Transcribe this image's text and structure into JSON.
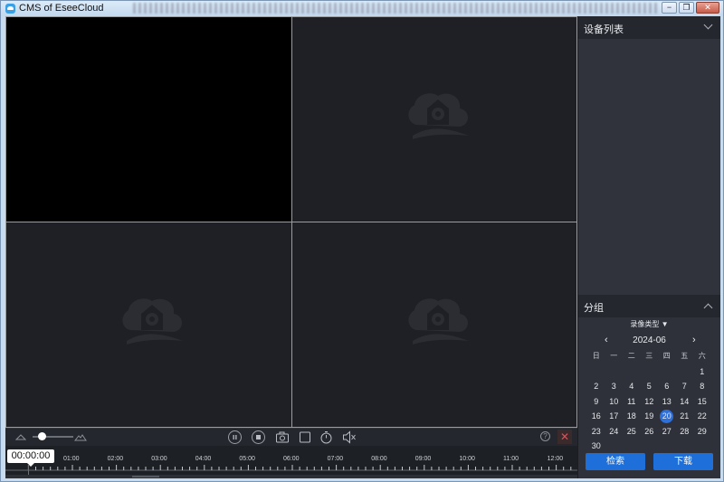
{
  "window": {
    "title": "CMS of EseeCloud",
    "minimize_label": "−",
    "restore_label": "❐",
    "close_label": "✕"
  },
  "panes": [
    {
      "name": "channel-1",
      "state": "black"
    },
    {
      "name": "channel-2",
      "state": "logo"
    },
    {
      "name": "channel-3",
      "state": "logo"
    },
    {
      "name": "channel-4",
      "state": "logo"
    }
  ],
  "controls": {
    "close_icon": "✕",
    "help_icon": "?"
  },
  "timeline": {
    "current_time": "00:00:00",
    "labels": [
      "01:00",
      "02:00",
      "03:00",
      "04:00",
      "05:00",
      "06:00",
      "07:00",
      "08:00",
      "09:00",
      "10:00",
      "11:00",
      "12:00"
    ]
  },
  "side": {
    "device_list_title": "设备列表",
    "group_title": "分组",
    "record_type_label": "录像类型 ▼",
    "calendar": {
      "month": "2024-06",
      "prev": "‹",
      "next": "›",
      "weekdays": [
        "日",
        "一",
        "二",
        "三",
        "四",
        "五",
        "六"
      ],
      "days": [
        "",
        "",
        "",
        "",
        "",
        "",
        "1",
        "2",
        "3",
        "4",
        "5",
        "6",
        "7",
        "8",
        "9",
        "10",
        "11",
        "12",
        "13",
        "14",
        "15",
        "16",
        "17",
        "18",
        "19",
        "20",
        "21",
        "22",
        "23",
        "24",
        "25",
        "26",
        "27",
        "28",
        "29",
        "30"
      ],
      "selected_day": "20"
    },
    "search_button": "检索",
    "download_button": "下载"
  },
  "colors": {
    "accent": "#1e6fd9",
    "pane_bg": "#1e2026",
    "panel_bg": "#2e3139"
  }
}
